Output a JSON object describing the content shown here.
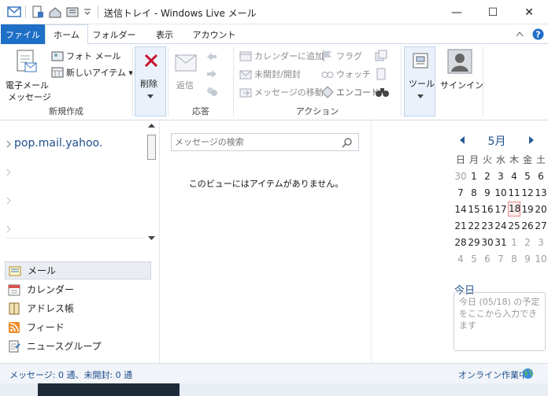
{
  "window": {
    "title": "送信トレイ - Windows Live メール",
    "controls": {
      "minimize": "—",
      "maximize": "☐",
      "close": "✕"
    }
  },
  "tabs": [
    {
      "label": "ファイル"
    },
    {
      "label": "ホーム"
    },
    {
      "label": "フォルダー"
    },
    {
      "label": "表示"
    },
    {
      "label": "アカウント"
    }
  ],
  "ribbon": {
    "new_group": {
      "label": "新規作成",
      "email_label_1": "電子メール",
      "email_label_2": "メッセージ",
      "photo_mail": "フォト メール",
      "new_item": "新しいアイテム ▾"
    },
    "delete_label": "削除",
    "respond_group": {
      "label": "応答",
      "reply": "返信"
    },
    "action_group": {
      "label": "アクション",
      "add_calendar": "カレンダーに追加",
      "unread_read": "未開封/開封",
      "move_message": "メッセージの移動",
      "flag": "フラグ",
      "watch": "ウォッチ",
      "encode": "エンコード"
    },
    "tools_label": "ツール",
    "signin_label": "サインイン"
  },
  "left_pane": {
    "accounts": [
      {
        "label": "pop.mail.yahoo."
      }
    ],
    "nav": [
      {
        "label": "メール",
        "icon": "mail-icon"
      },
      {
        "label": "カレンダー",
        "icon": "calendar-icon"
      },
      {
        "label": "アドレス帳",
        "icon": "address-book-icon"
      },
      {
        "label": "フィード",
        "icon": "feed-icon"
      },
      {
        "label": "ニュースグループ",
        "icon": "newsgroup-icon"
      }
    ]
  },
  "message_list": {
    "search_placeholder": "メッセージの検索",
    "empty_text": "このビューにはアイテムがありません。"
  },
  "calendar": {
    "month": "5月",
    "weekdays": [
      "日",
      "月",
      "火",
      "水",
      "木",
      "金",
      "土"
    ],
    "weeks": [
      [
        "30",
        "1",
        "2",
        "3",
        "4",
        "5",
        "6"
      ],
      [
        "7",
        "8",
        "9",
        "10",
        "11",
        "12",
        "13"
      ],
      [
        "14",
        "15",
        "16",
        "17",
        "18",
        "19",
        "20"
      ],
      [
        "21",
        "22",
        "23",
        "24",
        "25",
        "26",
        "27"
      ],
      [
        "28",
        "29",
        "30",
        "31",
        "1",
        "2",
        "3"
      ],
      [
        "4",
        "5",
        "6",
        "7",
        "8",
        "9",
        "10"
      ]
    ],
    "today": "18",
    "today_heading": "今日",
    "today_text": "今日 (05/18) の予定をここから入力できます"
  },
  "status": {
    "left": "メッセージ: 0 通、未開封: 0 通",
    "right": "オンライン作業中"
  },
  "colors": {
    "accent": "#1e6fc6",
    "delete_red": "#c8102e"
  }
}
